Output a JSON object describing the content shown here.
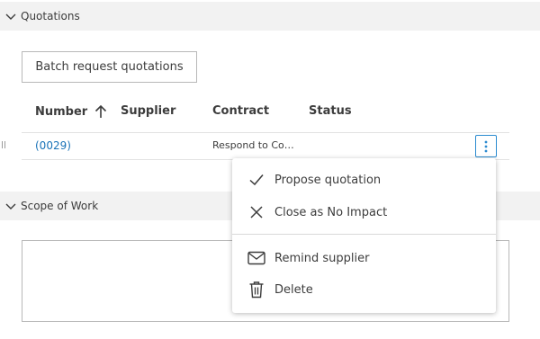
{
  "sections": {
    "quotations": {
      "title": "Quotations"
    },
    "scope": {
      "title": "Scope of Work"
    }
  },
  "toolbar": {
    "batch_label": "Batch request quotations"
  },
  "table": {
    "columns": [
      {
        "label": "Number",
        "sort": "ascending"
      },
      {
        "label": "Supplier"
      },
      {
        "label": "Contract"
      },
      {
        "label": "Status"
      }
    ],
    "rows": [
      {
        "number": "(0029)",
        "supplier": "",
        "contract": "Respond to Co…",
        "status": ""
      }
    ]
  },
  "menu": {
    "items": [
      {
        "label": "Propose quotation",
        "icon": "check-icon"
      },
      {
        "label": "Close as No Impact",
        "icon": "close-icon"
      },
      {
        "label": "Remind supplier",
        "icon": "envelope-icon"
      },
      {
        "label": "Delete",
        "icon": "trash-icon"
      }
    ]
  },
  "colors": {
    "link": "#1a73b8",
    "accent_border": "#2b8bd0",
    "header_bg": "#f2f2f2"
  }
}
